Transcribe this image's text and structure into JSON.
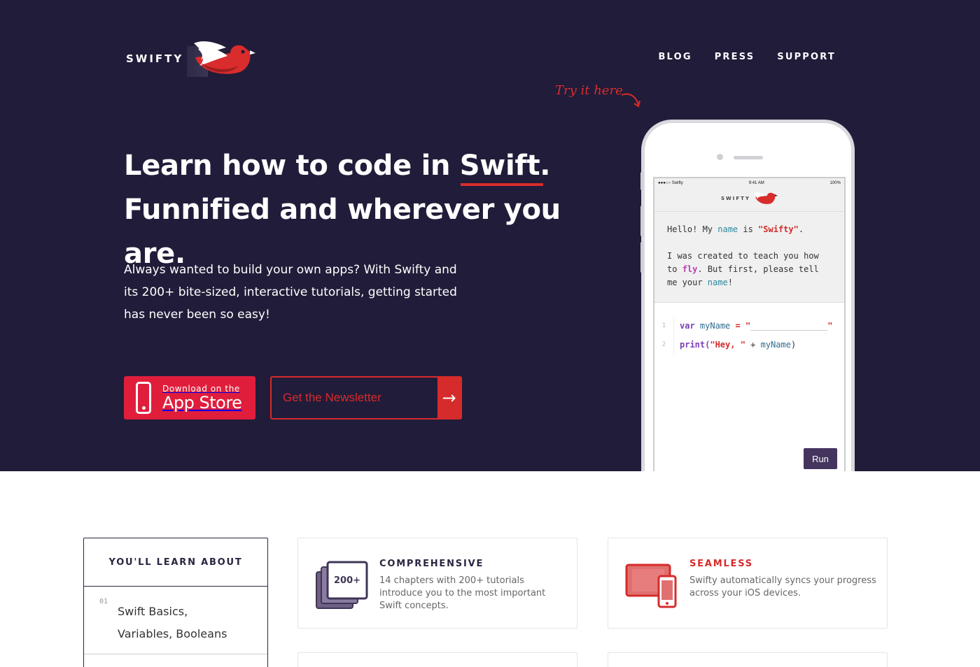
{
  "logo": {
    "text": "SWIFTY"
  },
  "nav": {
    "items": [
      "BLOG",
      "PRESS",
      "SUPPORT"
    ]
  },
  "hero": {
    "title_prefix": "Learn how to code in ",
    "title_accent": "Swift.",
    "title_line2": "Funnified and wherever you are.",
    "description": "Always wanted to build your own apps? With Swifty and its 200+ bite-sized, interactive tutorials, getting started has never been so easy!",
    "appstore_small": "Download on the",
    "appstore_big": "App Store",
    "newsletter_placeholder": "Get the Newsletter",
    "newsletter_arrow": "→",
    "try_it": "Try it here"
  },
  "phone": {
    "status_left": "●●●○○ Swifty",
    "status_time": "9:41 AM",
    "status_right": "100%",
    "mini_logo": "SWIFTY",
    "chat_line1_a": "Hello! My ",
    "chat_line1_kw": "name",
    "chat_line1_b": " is ",
    "chat_line1_str": "\"Swifty\"",
    "chat_line1_c": ".",
    "chat_line2_a": "I was created to teach you how to ",
    "chat_line2_fn": "fly",
    "chat_line2_b": ". But first, please tell me your ",
    "chat_line2_kw": "name",
    "chat_line2_c": "!",
    "code": [
      {
        "num": "1",
        "var": "var",
        "id": "myName",
        "rest": " = \""
      },
      {
        "num": "2",
        "call": "print(",
        "str": "\"Hey, \"",
        "rest": " + ",
        "id": "myName",
        "end": ")"
      }
    ],
    "run_label": "Run"
  },
  "learn": {
    "heading": "YOU'LL LEARN ABOUT",
    "items": [
      {
        "num": "01",
        "line1": "Swift Basics,",
        "line2": "Variables, Booleans"
      }
    ]
  },
  "features": [
    {
      "title": "COMPREHENSIVE",
      "badge": "200+",
      "text": "14 chapters with 200+ tutorials introduce you to the most important Swift concepts."
    },
    {
      "title": "SEAMLESS",
      "text": "Swifty automatically syncs your progress across your iOS devices."
    }
  ],
  "colors": {
    "hero_bg": "#211c39",
    "accent": "#d92c2c",
    "appstore": "#e01e3c",
    "run_button": "#44355e"
  }
}
